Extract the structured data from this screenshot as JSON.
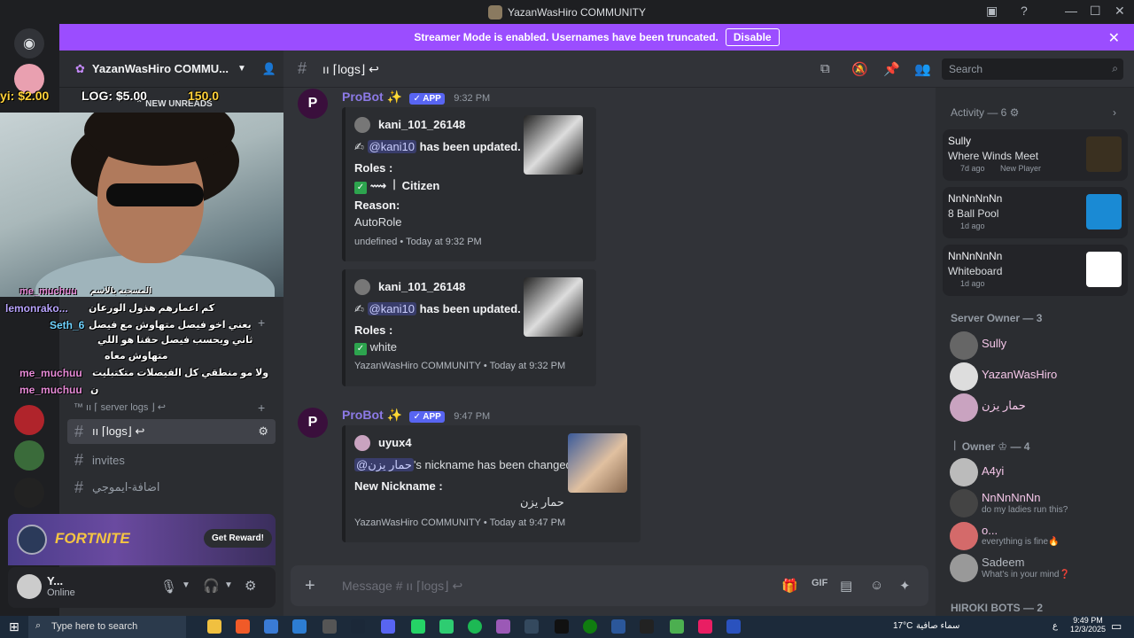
{
  "window": {
    "title": "YazanWasHiro COMMUNITY"
  },
  "banner": {
    "text": "Streamer Mode is enabled. Usernames have been truncated.",
    "button": "Disable"
  },
  "server": {
    "name": "YazanWasHiro COMMU..."
  },
  "new_unreads": "NEW UNREADS",
  "channels": {
    "category": "™ ıı ⌈ server logs ⌋ ↩",
    "logs": "ıı ⌈logs⌋ ↩",
    "invites": "invites",
    "emoji": "اضافة-ايموجي"
  },
  "overlay": {
    "money1": "yi: $2.00",
    "money2": "LOG: $5.00",
    "money3": "150.0",
    "chat": [
      {
        "user": "me_muchuu",
        "text": "المسحبه بالاسم"
      },
      {
        "user": "lemonrako...",
        "text": "كم اعمارهم هذول الورعان"
      },
      {
        "user": "Seth_6",
        "text": "يعني اخو فيصل متهاوش مع فيصل"
      },
      {
        "user": "",
        "text": "ثاني ويحسب فيصل حقنا هو اللي"
      },
      {
        "user": "",
        "text": "متهاوش معاه"
      },
      {
        "user": "me_muchuu",
        "text": "ولا مو منطقي كل الفيصلات متكتبليت"
      },
      {
        "user": "me_muchuu",
        "text": "ن"
      }
    ]
  },
  "promo": {
    "game": "FORTNITE",
    "button": "Get Reward!"
  },
  "user": {
    "name": "Y...",
    "status": "Online"
  },
  "channel_header": {
    "name": "ıı ⌈logs⌋ ↩",
    "search_placeholder": "Search"
  },
  "messages": [
    {
      "author": "ProBot ✨",
      "tag": "✓ APP",
      "time": "9:32 PM",
      "embeds": [
        {
          "user": "kani_101_26148",
          "mention": "@kani10",
          "action": "has been updated.",
          "roles_label": "Roles :",
          "role": "⟿ ꒐ Citizen",
          "reason_label": "Reason:",
          "reason": "AutoRole",
          "footer": "undefined • Today at 9:32 PM"
        },
        {
          "user": "kani_101_26148",
          "mention": "@kani10",
          "action": "has been updated.",
          "roles_label": "Roles :",
          "role": "white",
          "footer": "YazanWasHiro COMMUNITY • Today at 9:32 PM"
        }
      ]
    },
    {
      "author": "ProBot ✨",
      "tag": "✓ APP",
      "time": "9:47 PM",
      "embeds": [
        {
          "user": "uyux4",
          "mention": "@حمار يزن",
          "action": "'s nickname has been changed.",
          "nick_label": "New Nickname :",
          "nick": "حمار يزن",
          "footer": "YazanWasHiro COMMUNITY • Today at 9:47 PM"
        }
      ]
    }
  ],
  "composer": {
    "placeholder": "Message # ıı ⌈logs⌋ ↩"
  },
  "activity": {
    "header": "Activity — 6 ⚙",
    "cards": [
      {
        "user": "Sully",
        "title": "Where Winds Meet",
        "meta": "7d ago",
        "meta2": "New Player"
      },
      {
        "user": "NnNnNnNn",
        "title": "8 Ball Pool",
        "meta": "1d ago"
      },
      {
        "user": "NnNnNnNn",
        "title": "Whiteboard",
        "meta": "1d ago"
      }
    ]
  },
  "member_groups": [
    {
      "header": "Server Owner — 3",
      "members": [
        {
          "name": "Sully"
        },
        {
          "name": "YazanWasHiro"
        },
        {
          "name": "حمار يزن"
        }
      ]
    },
    {
      "header": "꒐ Owner ♔ — 4",
      "members": [
        {
          "name": "A4yi",
          "status": ""
        },
        {
          "name": "NnNnNnNn",
          "status": "do my ladies run this?"
        },
        {
          "name": "o...",
          "status": "everything is fine🔥"
        },
        {
          "name": "Sadeem",
          "status": "What's in your mind❓"
        }
      ]
    },
    {
      "header": "HIROKI BOTS — 2",
      "members": []
    }
  ],
  "taskbar": {
    "search": "Type here to search",
    "weather": "17°C",
    "weather_text": "سماء صافية",
    "time": "9:49 PM",
    "date": "12/3/2025",
    "lang": "ع"
  },
  "colors": {
    "accent": "#5865f2",
    "banner": "#9b4dff",
    "bot": "#8c7ae6"
  }
}
